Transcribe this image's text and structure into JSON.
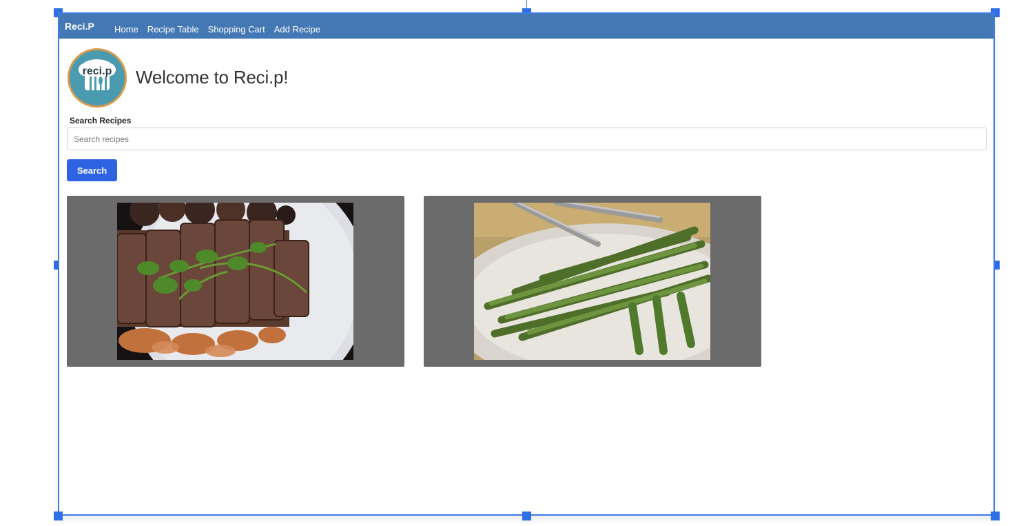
{
  "navbar": {
    "brand": "Reci.P",
    "links": [
      "Home",
      "Recipe Table",
      "Shopping Cart",
      "Add Recipe"
    ]
  },
  "logo": {
    "text": "reci.p"
  },
  "page_title": "Welcome to Reci.p!",
  "search": {
    "label": "Search Recipes",
    "placeholder": "Search recipes",
    "value": "",
    "button_label": "Search"
  },
  "recipes": [
    {
      "image": "braised-beef-with-cilantro-photo"
    },
    {
      "image": "roasted-asparagus-with-tongs-photo"
    }
  ],
  "colors": {
    "navbar": "#4478b4",
    "button": "#2e64e4",
    "card_background": "#6b6b6b",
    "selection_frame": "#3f7be8"
  }
}
